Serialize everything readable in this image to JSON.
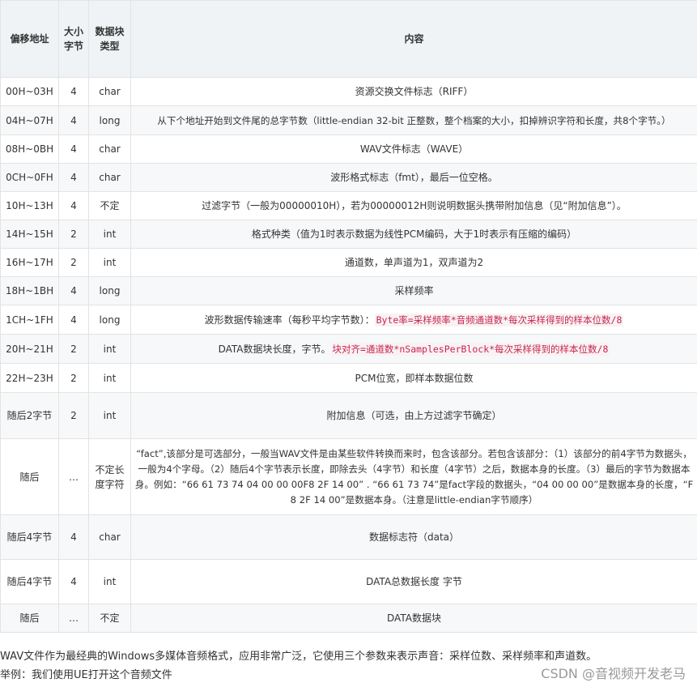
{
  "table": {
    "headers": [
      "偏移地址",
      "大小字节",
      "数据块类型",
      "内容"
    ],
    "rows": [
      {
        "offset": "00H~03H",
        "size": "4",
        "type": "char",
        "content": "资源交换文件标志（RIFF）"
      },
      {
        "offset": "04H~07H",
        "size": "4",
        "type": "long",
        "content": "从下个地址开始到文件尾的总字节数（little-endian 32-bit 正整数，整个档案的大小，扣掉辨识字符和长度，共8个字节。）"
      },
      {
        "offset": "08H~0BH",
        "size": "4",
        "type": "char",
        "content": "WAV文件标志（WAVE）"
      },
      {
        "offset": "0CH~0FH",
        "size": "4",
        "type": "char",
        "content": "波形格式标志（fmt），最后一位空格。"
      },
      {
        "offset": "10H~13H",
        "size": "4",
        "type": "不定",
        "content": "过滤字节（一般为00000010H），若为00000012H则说明数据头携带附加信息（见“附加信息”）。"
      },
      {
        "offset": "14H~15H",
        "size": "2",
        "type": "int",
        "content": "格式种类（值为1时表示数据为线性PCM编码，大于1时表示有压缩的编码）"
      },
      {
        "offset": "16H~17H",
        "size": "2",
        "type": "int",
        "content": "通道数，单声道为1，双声道为2"
      },
      {
        "offset": "18H~1BH",
        "size": "4",
        "type": "long",
        "content": "采样频率"
      },
      {
        "offset": "1CH~1FH",
        "size": "4",
        "type": "long",
        "content": "波形数据传输速率（每秒平均字节数）：",
        "code": "Byte率=采样频率*音频通道数*每次采样得到的样本位数/8"
      },
      {
        "offset": "20H~21H",
        "size": "2",
        "type": "int",
        "content": "DATA数据块长度，字节。",
        "code": "块对齐=通道数*nSamplesPerBlock*每次采样得到的样本位数/8"
      },
      {
        "offset": "22H~23H",
        "size": "2",
        "type": "int",
        "content": "PCM位宽，即样本数据位数"
      },
      {
        "offset": "随后2字节",
        "size": "2",
        "type": "int",
        "content": "附加信息（可选，由上方过滤字节确定）"
      },
      {
        "offset": "随后",
        "size": "…",
        "type": "不定长度字符",
        "content": "“fact”,该部分是可选部分，一般当WAV文件是由某些软件转换而来时，包含该部分。若包含该部分：（1）该部分的前4字节为数据头，一般为4个字母。（2）随后4个字节表示长度，即除去头（4字节）和长度（4字节）之后，数据本身的长度。（3）最后的字节为数据本身。例如：“66 61 73 74 04 00 00 00F8 2F 14 00” . “66 61 73 74”是fact字段的数据头，“04 00 00 00”是数据本身的长度，“F8 2F 14 00”是数据本身。（注意是little-endian字节顺序）"
      },
      {
        "offset": "随后4字节",
        "size": "4",
        "type": "char",
        "content": "数据标志符（data）"
      },
      {
        "offset": "随后4字节",
        "size": "4",
        "type": "int",
        "content": "DATA总数据长度 字节"
      },
      {
        "offset": "随后",
        "size": "…",
        "type": "不定",
        "content": "DATA数据块"
      }
    ]
  },
  "paragraphs": [
    "WAV文件作为最经典的Windows多媒体音频格式，应用非常广泛，它使用三个参数来表示声音：采样位数、采样频率和声道数。",
    "举例：我们使用UE打开这个音频文件"
  ],
  "watermark": "CSDN @音视频开发老马",
  "colors": {
    "header_bg": "#eff3f5",
    "stripe_bg": "#f6f8fa",
    "border": "#e3e3e3",
    "code_text": "#c7254e",
    "code_bg": "#f9f2f4"
  }
}
